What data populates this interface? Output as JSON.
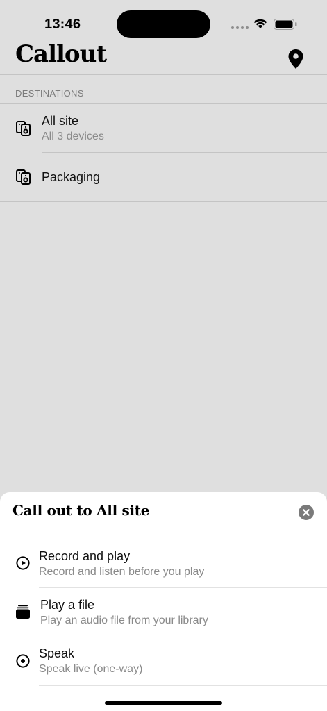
{
  "status_bar": {
    "time": "13:46",
    "icons": [
      "signal-icon",
      "wifi-icon",
      "battery-icon"
    ]
  },
  "header": {
    "title": "Callout",
    "location_icon": "location-pin-icon"
  },
  "destinations": {
    "section_label": "DESTINATIONS",
    "items": [
      {
        "title": "All site",
        "subtitle": "All 3 devices",
        "icon": "speakers-icon"
      },
      {
        "title": "Packaging",
        "subtitle": "",
        "icon": "speakers-icon"
      }
    ]
  },
  "sheet": {
    "title": "Call out to All site",
    "close_icon": "close-icon",
    "options": [
      {
        "title": "Record and play",
        "subtitle": "Record and listen before you play",
        "icon": "play-circle-icon"
      },
      {
        "title": "Play a file",
        "subtitle": "Play an audio file from your library",
        "icon": "stack-icon"
      },
      {
        "title": "Speak",
        "subtitle": "Speak live (one-way)",
        "icon": "record-circle-icon"
      }
    ]
  },
  "colors": {
    "background": "#dfdfdf",
    "sheet": "#ffffff",
    "secondary_text": "#8a8a8a",
    "close_button": "#7a7a7a"
  }
}
